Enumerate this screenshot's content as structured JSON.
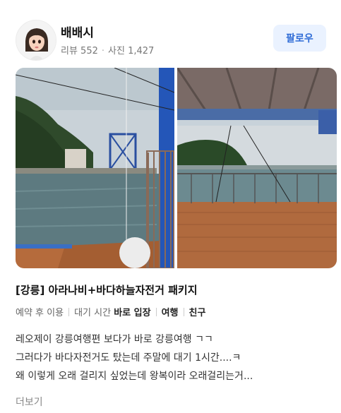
{
  "user": {
    "name": "배배시",
    "review_label": "리뷰 552",
    "photo_label": "사진 1,427",
    "separator": "·"
  },
  "follow_button": "팔로우",
  "photos": [
    {
      "icon": "photo-bridge-pier-view"
    },
    {
      "icon": "photo-deck-sea-view"
    }
  ],
  "review": {
    "title": "[강릉] 아라나비+바다하늘자전거 패키지",
    "tags": {
      "reservation": "예약 후 이용",
      "wait_prefix": "대기 시간",
      "wait_value": "바로 입장",
      "purpose": "여행",
      "companion": "친구"
    },
    "lines": [
      "레오제이 강릉여행편 보다가 바로 강릉여행 ㄱㄱ",
      "그러다가 바다자전거도 탔는데 주말에 대기 1시간....ㅋ",
      "왜 이렇게 오래 걸리지 싶었는데 왕복이라 오래걸리는거..."
    ],
    "more_label": "더보기"
  }
}
